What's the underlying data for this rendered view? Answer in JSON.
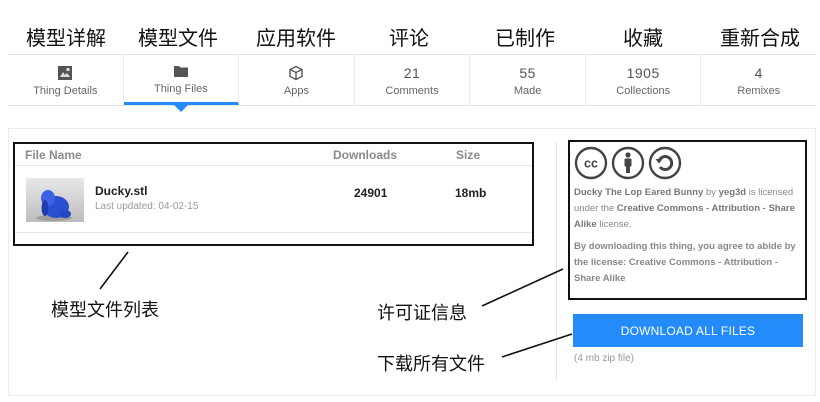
{
  "annotations_top": [
    "模型详解",
    "模型文件",
    "应用软件",
    "评论",
    "已制作",
    "收藏",
    "重新合成"
  ],
  "tabs": [
    {
      "label": "Thing Details",
      "count": "",
      "icon": "photo-icon",
      "active": false
    },
    {
      "label": "Thing Files",
      "count": "",
      "icon": "folder-icon",
      "active": true
    },
    {
      "label": "Apps",
      "count": "",
      "icon": "cube-icon",
      "active": false
    },
    {
      "label": "Comments",
      "count": "21",
      "icon": "",
      "active": false
    },
    {
      "label": "Made",
      "count": "55",
      "icon": "",
      "active": false
    },
    {
      "label": "Collections",
      "count": "1905",
      "icon": "",
      "active": false
    },
    {
      "label": "Remixes",
      "count": "4",
      "icon": "",
      "active": false
    }
  ],
  "files": {
    "headers": {
      "name": "File Name",
      "downloads": "Downloads",
      "size": "Size"
    },
    "rows": [
      {
        "name": "Ducky.stl",
        "updated": "Last updated: 04-02-15",
        "downloads": "24901",
        "size": "18mb"
      }
    ]
  },
  "license": {
    "icons": [
      "cc-icon",
      "attribution-icon",
      "share-alike-icon"
    ],
    "cc_text": "cc",
    "thing_name": "Ducky The Lop Eared Bunny",
    "by": "by",
    "author": "yeg3d",
    "licensed_under": "is licensed under the",
    "license_name": "Creative Commons - Attribution - Share Alike",
    "license_suffix": "license.",
    "agreement": "By downloading this thing, you agree to abide by the license: Creative Commons - Attribution - Share Alike"
  },
  "download": {
    "label": "DOWNLOAD ALL FILES",
    "note": "(4 mb zip file)"
  },
  "annotations_bottom": {
    "file_list": "模型文件列表",
    "license_info": "许可证信息",
    "download_all": "下载所有文件"
  },
  "colors": {
    "accent": "#248bfb"
  }
}
